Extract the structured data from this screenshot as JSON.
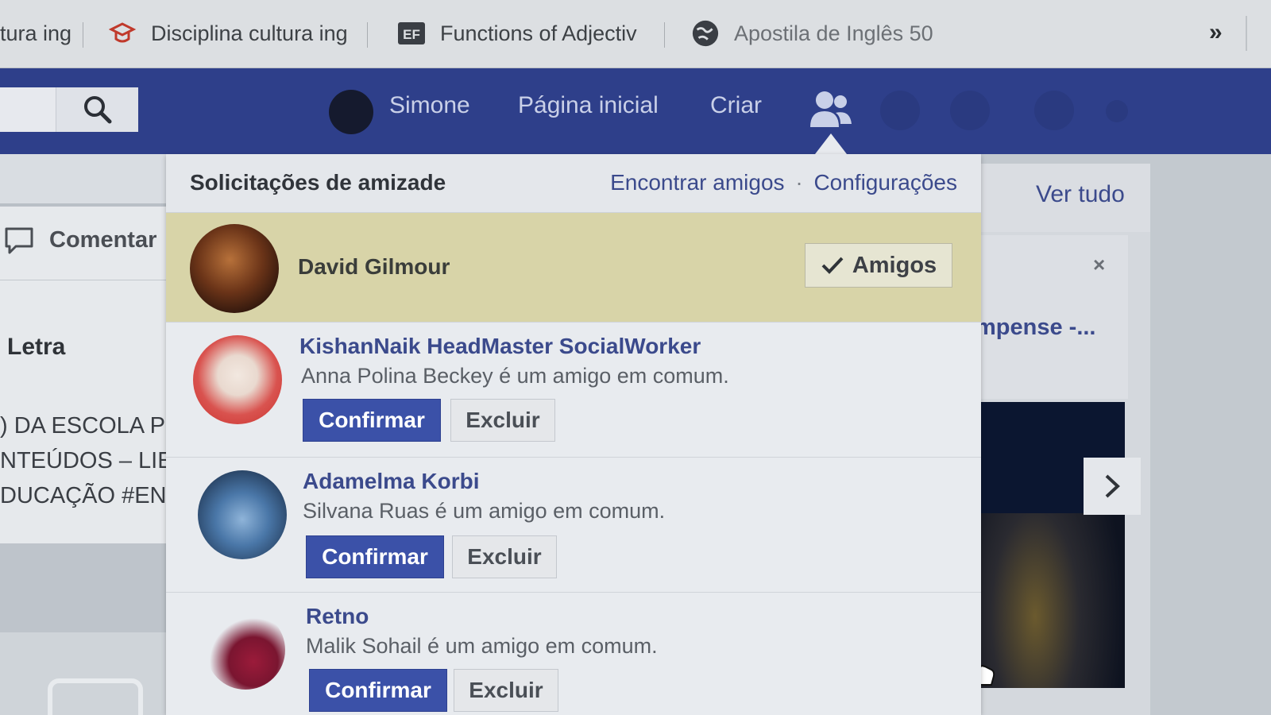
{
  "bookmarks": [
    {
      "label": "tura ing",
      "icon": "page-icon"
    },
    {
      "label": "Disciplina cultura ing",
      "icon": "graduation-cap-icon"
    },
    {
      "label": "Functions of Adjectiv",
      "icon": "ef-logo-icon"
    },
    {
      "label": "Apostila de Inglês 50",
      "icon": "globe-icon"
    }
  ],
  "overflow_label": "»",
  "header": {
    "user_name": "Simone",
    "home": "Página inicial",
    "create": "Criar"
  },
  "left_feed": {
    "comment_label": "Comentar",
    "heading": "Letra",
    "lines": [
      ") DA ESCOLA P",
      "NTEÚDOS – LIE",
      "DUCAÇÃO #EN"
    ]
  },
  "right_panel": {
    "see_all": "Ver tudo",
    "close": "×",
    "snippet": "mpense -..."
  },
  "friend_requests": {
    "title": "Solicitações de amizade",
    "find_friends": "Encontrar amigos",
    "separator": "·",
    "settings": "Configurações",
    "accepted": {
      "name": "David Gilmour",
      "button": "Amigos"
    },
    "pending": [
      {
        "name": "KishanNaik HeadMaster SocialWorker",
        "mutual": "Anna Polina Beckey é um amigo em comum.",
        "confirm": "Confirmar",
        "delete": "Excluir"
      },
      {
        "name": "Adamelma Korbi",
        "mutual": "Silvana Ruas é um amigo em comum.",
        "confirm": "Confirmar",
        "delete": "Excluir"
      },
      {
        "name": "Retno",
        "mutual": "Malik Sohail é um amigo em comum.",
        "confirm": "Confirmar",
        "delete": "Excluir"
      }
    ]
  },
  "colors": {
    "fb_blue": "#2e3f8a",
    "confirm_button": "#3b51a8",
    "link": "#3b4a8c",
    "accepted_highlight": "#d8d4a8"
  }
}
